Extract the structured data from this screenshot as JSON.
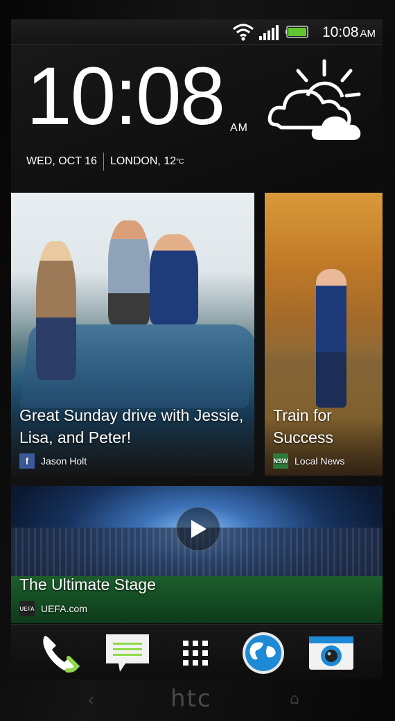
{
  "status_bar": {
    "time": "10:08",
    "ampm": "AM",
    "icons": [
      "wifi-icon",
      "signal-icon",
      "battery-icon"
    ]
  },
  "clock": {
    "time": "10:08",
    "ampm": "AM",
    "date": "WED, OCT 16",
    "location": "LONDON,",
    "temperature": "12",
    "temperature_unit": "°C"
  },
  "weather": {
    "icon": "partly-cloudy-icon"
  },
  "feed": [
    {
      "title": "Great Sunday drive with Jessie, Lisa, and Peter!",
      "source": "Jason Holt",
      "source_icon": "facebook-icon",
      "source_logo_text": "f"
    },
    {
      "title": "Train for Success",
      "source": "Local News",
      "source_icon": "local-news-icon",
      "source_logo_text": "NSW"
    },
    {
      "title": "The Ultimate Stage",
      "source": "UEFA.com",
      "source_icon": "uefa-icon",
      "source_logo_text": "UEFA",
      "has_video": true
    }
  ],
  "dock": [
    {
      "name": "phone",
      "icon": "phone-icon"
    },
    {
      "name": "messages",
      "icon": "message-icon"
    },
    {
      "name": "apps",
      "icon": "app-grid-icon"
    },
    {
      "name": "browser",
      "icon": "globe-icon"
    },
    {
      "name": "camera",
      "icon": "camera-icon"
    }
  ],
  "nav": {
    "back": "‹",
    "brand": "htc",
    "home": "⌂"
  },
  "colors": {
    "accent_green": "#8fd94a",
    "battery_green": "#5ec62e",
    "facebook_blue": "#3b5998",
    "camera_blue": "#1e8ad6"
  }
}
